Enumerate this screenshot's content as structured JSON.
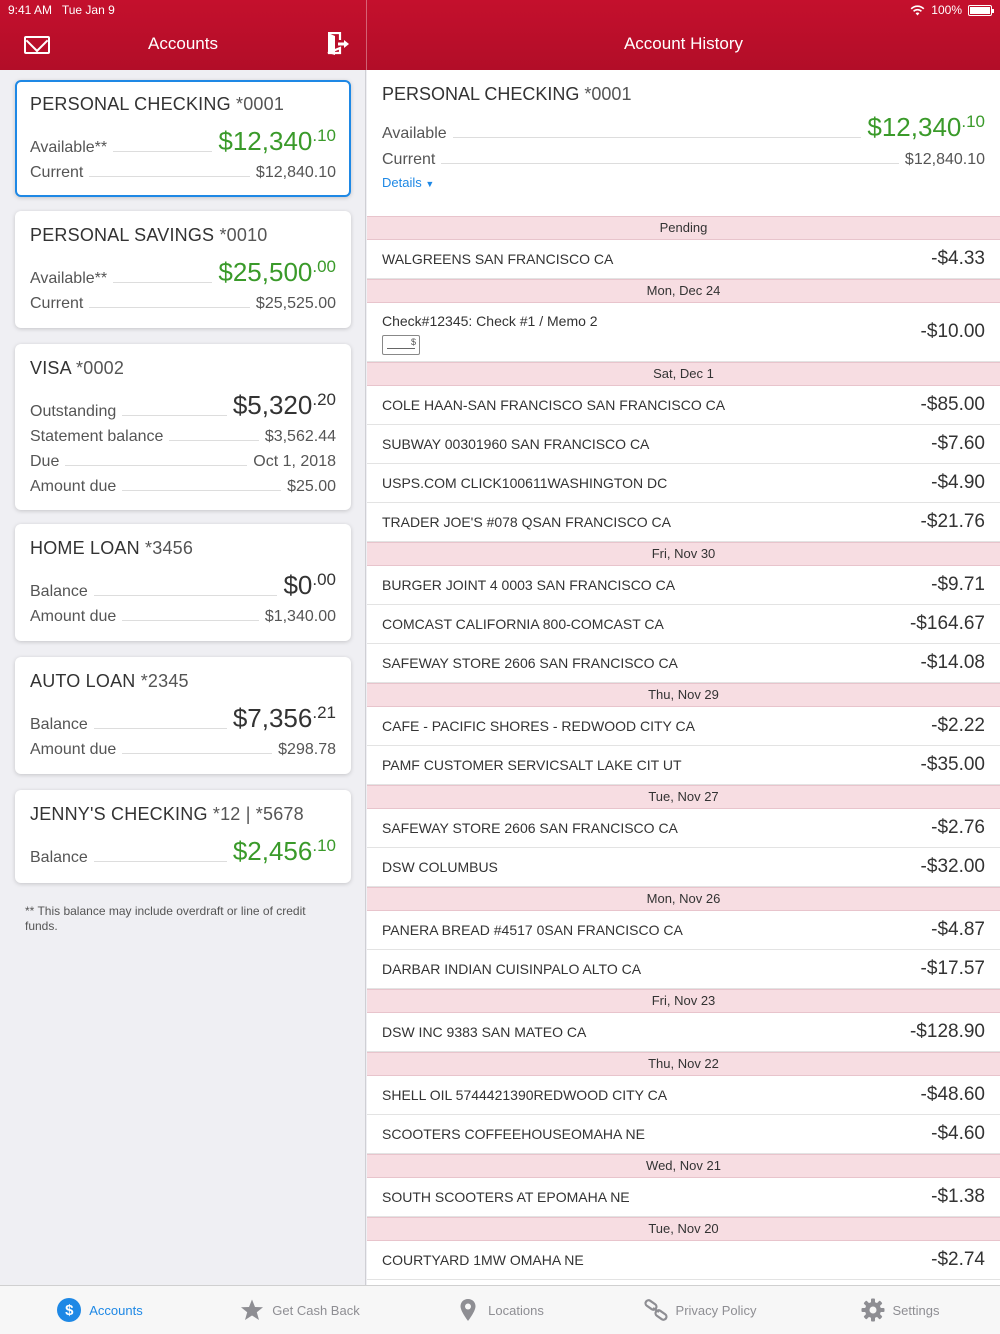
{
  "status": {
    "time": "9:41 AM",
    "date": "Tue Jan 9",
    "battery": "100%"
  },
  "header": {
    "left_title": "Accounts",
    "right_title": "Account History"
  },
  "accounts": [
    {
      "name": "PERSONAL CHECKING",
      "number": "*0001",
      "rows": [
        {
          "label": "Available**",
          "whole": "$12,340",
          "cents": ".10"
        },
        {
          "label": "Current",
          "value": "$12,840.10"
        }
      ]
    },
    {
      "name": "PERSONAL SAVINGS",
      "number": "*0010",
      "rows": [
        {
          "label": "Available**",
          "whole": "$25,500",
          "cents": ".00"
        },
        {
          "label": "Current",
          "value": "$25,525.00"
        }
      ]
    },
    {
      "name": "VISA",
      "number": "*0002",
      "rows": [
        {
          "label": "Outstanding",
          "whole": "$5,320",
          "cents": ".20"
        },
        {
          "label": "Statement balance",
          "value": "$3,562.44"
        },
        {
          "label": "Due",
          "value": "Oct 1, 2018"
        },
        {
          "label": "Amount due",
          "value": "$25.00"
        }
      ]
    },
    {
      "name": "HOME LOAN",
      "number": "*3456",
      "rows": [
        {
          "label": "Balance",
          "whole": "$0",
          "cents": ".00"
        },
        {
          "label": "Amount due",
          "value": "$1,340.00"
        }
      ]
    },
    {
      "name": "AUTO LOAN",
      "number": "*2345",
      "rows": [
        {
          "label": "Balance",
          "whole": "$7,356",
          "cents": ".21"
        },
        {
          "label": "Amount due",
          "value": "$298.78"
        }
      ]
    },
    {
      "name": "JENNY'S CHECKING",
      "number": "*12 | *5678",
      "rows": [
        {
          "label": "Balance",
          "whole": "$2,456",
          "cents": ".10"
        }
      ]
    }
  ],
  "footnote": "** This balance may include overdraft or line of credit funds.",
  "summary": {
    "name": "PERSONAL CHECKING",
    "number": "*0001",
    "available_label": "Available",
    "available_whole": "$12,340",
    "available_cents": ".10",
    "current_label": "Current",
    "current_value": "$12,840.10",
    "details_label": "Details"
  },
  "history": [
    {
      "date": "Pending",
      "items": [
        {
          "desc": "WALGREENS SAN FRANCISCO CA",
          "amount": "-$4.33"
        }
      ]
    },
    {
      "date": "Mon, Dec 24",
      "items": [
        {
          "desc": "Check#12345: Check #1 / Memo 2",
          "amount": "-$10.00",
          "check": true
        }
      ]
    },
    {
      "date": "Sat, Dec 1",
      "items": [
        {
          "desc": "COLE HAAN-SAN FRANCISCO SAN FRANCISCO CA",
          "amount": "-$85.00"
        },
        {
          "desc": "SUBWAY 00301960 SAN FRANCISCO CA",
          "amount": "-$7.60"
        },
        {
          "desc": "USPS.COM CLICK100611WASHINGTON DC",
          "amount": "-$4.90"
        },
        {
          "desc": "TRADER JOE'S #078 QSAN FRANCISCO CA",
          "amount": "-$21.76"
        }
      ]
    },
    {
      "date": "Fri, Nov 30",
      "items": [
        {
          "desc": "BURGER JOINT 4 0003 SAN FRANCISCO CA",
          "amount": "-$9.71"
        },
        {
          "desc": "COMCAST CALIFORNIA 800-COMCAST CA",
          "amount": "-$164.67"
        },
        {
          "desc": "SAFEWAY STORE 2606 SAN FRANCISCO CA",
          "amount": "-$14.08"
        }
      ]
    },
    {
      "date": "Thu, Nov 29",
      "items": [
        {
          "desc": "CAFE - PACIFIC SHORES - REDWOOD CITY CA",
          "amount": "-$2.22"
        },
        {
          "desc": "PAMF CUSTOMER SERVICSALT LAKE CIT UT",
          "amount": "-$35.00"
        }
      ]
    },
    {
      "date": "Tue, Nov 27",
      "items": [
        {
          "desc": "SAFEWAY STORE 2606 SAN FRANCISCO CA",
          "amount": "-$2.76"
        },
        {
          "desc": "DSW COLUMBUS",
          "amount": "-$32.00"
        }
      ]
    },
    {
      "date": "Mon, Nov 26",
      "items": [
        {
          "desc": "PANERA BREAD #4517 0SAN FRANCISCO CA",
          "amount": "-$4.87"
        },
        {
          "desc": "DARBAR INDIAN CUISINPALO ALTO CA",
          "amount": "-$17.57"
        }
      ]
    },
    {
      "date": "Fri, Nov 23",
      "items": [
        {
          "desc": "DSW INC 9383 SAN MATEO CA",
          "amount": "-$128.90"
        }
      ]
    },
    {
      "date": "Thu, Nov 22",
      "items": [
        {
          "desc": "SHELL OIL 5744421390REDWOOD CITY CA",
          "amount": "-$48.60"
        },
        {
          "desc": "SCOOTERS COFFEEHOUSEOMAHA NE",
          "amount": "-$4.60"
        }
      ]
    },
    {
      "date": "Wed, Nov 21",
      "items": [
        {
          "desc": "SOUTH SCOOTERS AT EPOMAHA NE",
          "amount": "-$1.38"
        }
      ]
    },
    {
      "date": "Tue, Nov 20",
      "items": [
        {
          "desc": "COURTYARD 1MW OMAHA NE",
          "amount": "-$2.74"
        }
      ]
    }
  ],
  "tabs": [
    {
      "label": "Accounts",
      "icon": "dollar-circle-icon",
      "active": true
    },
    {
      "label": "Get Cash Back",
      "icon": "star-icon",
      "active": false
    },
    {
      "label": "Locations",
      "icon": "location-pin-icon",
      "active": false
    },
    {
      "label": "Privacy Policy",
      "icon": "link-icon",
      "active": false
    },
    {
      "label": "Settings",
      "icon": "gear-icon",
      "active": false
    }
  ],
  "colors": {
    "brand": "#c4102d",
    "positive": "#3a9a2a",
    "accent": "#1e88e5",
    "date_header": "#f7dde2"
  }
}
